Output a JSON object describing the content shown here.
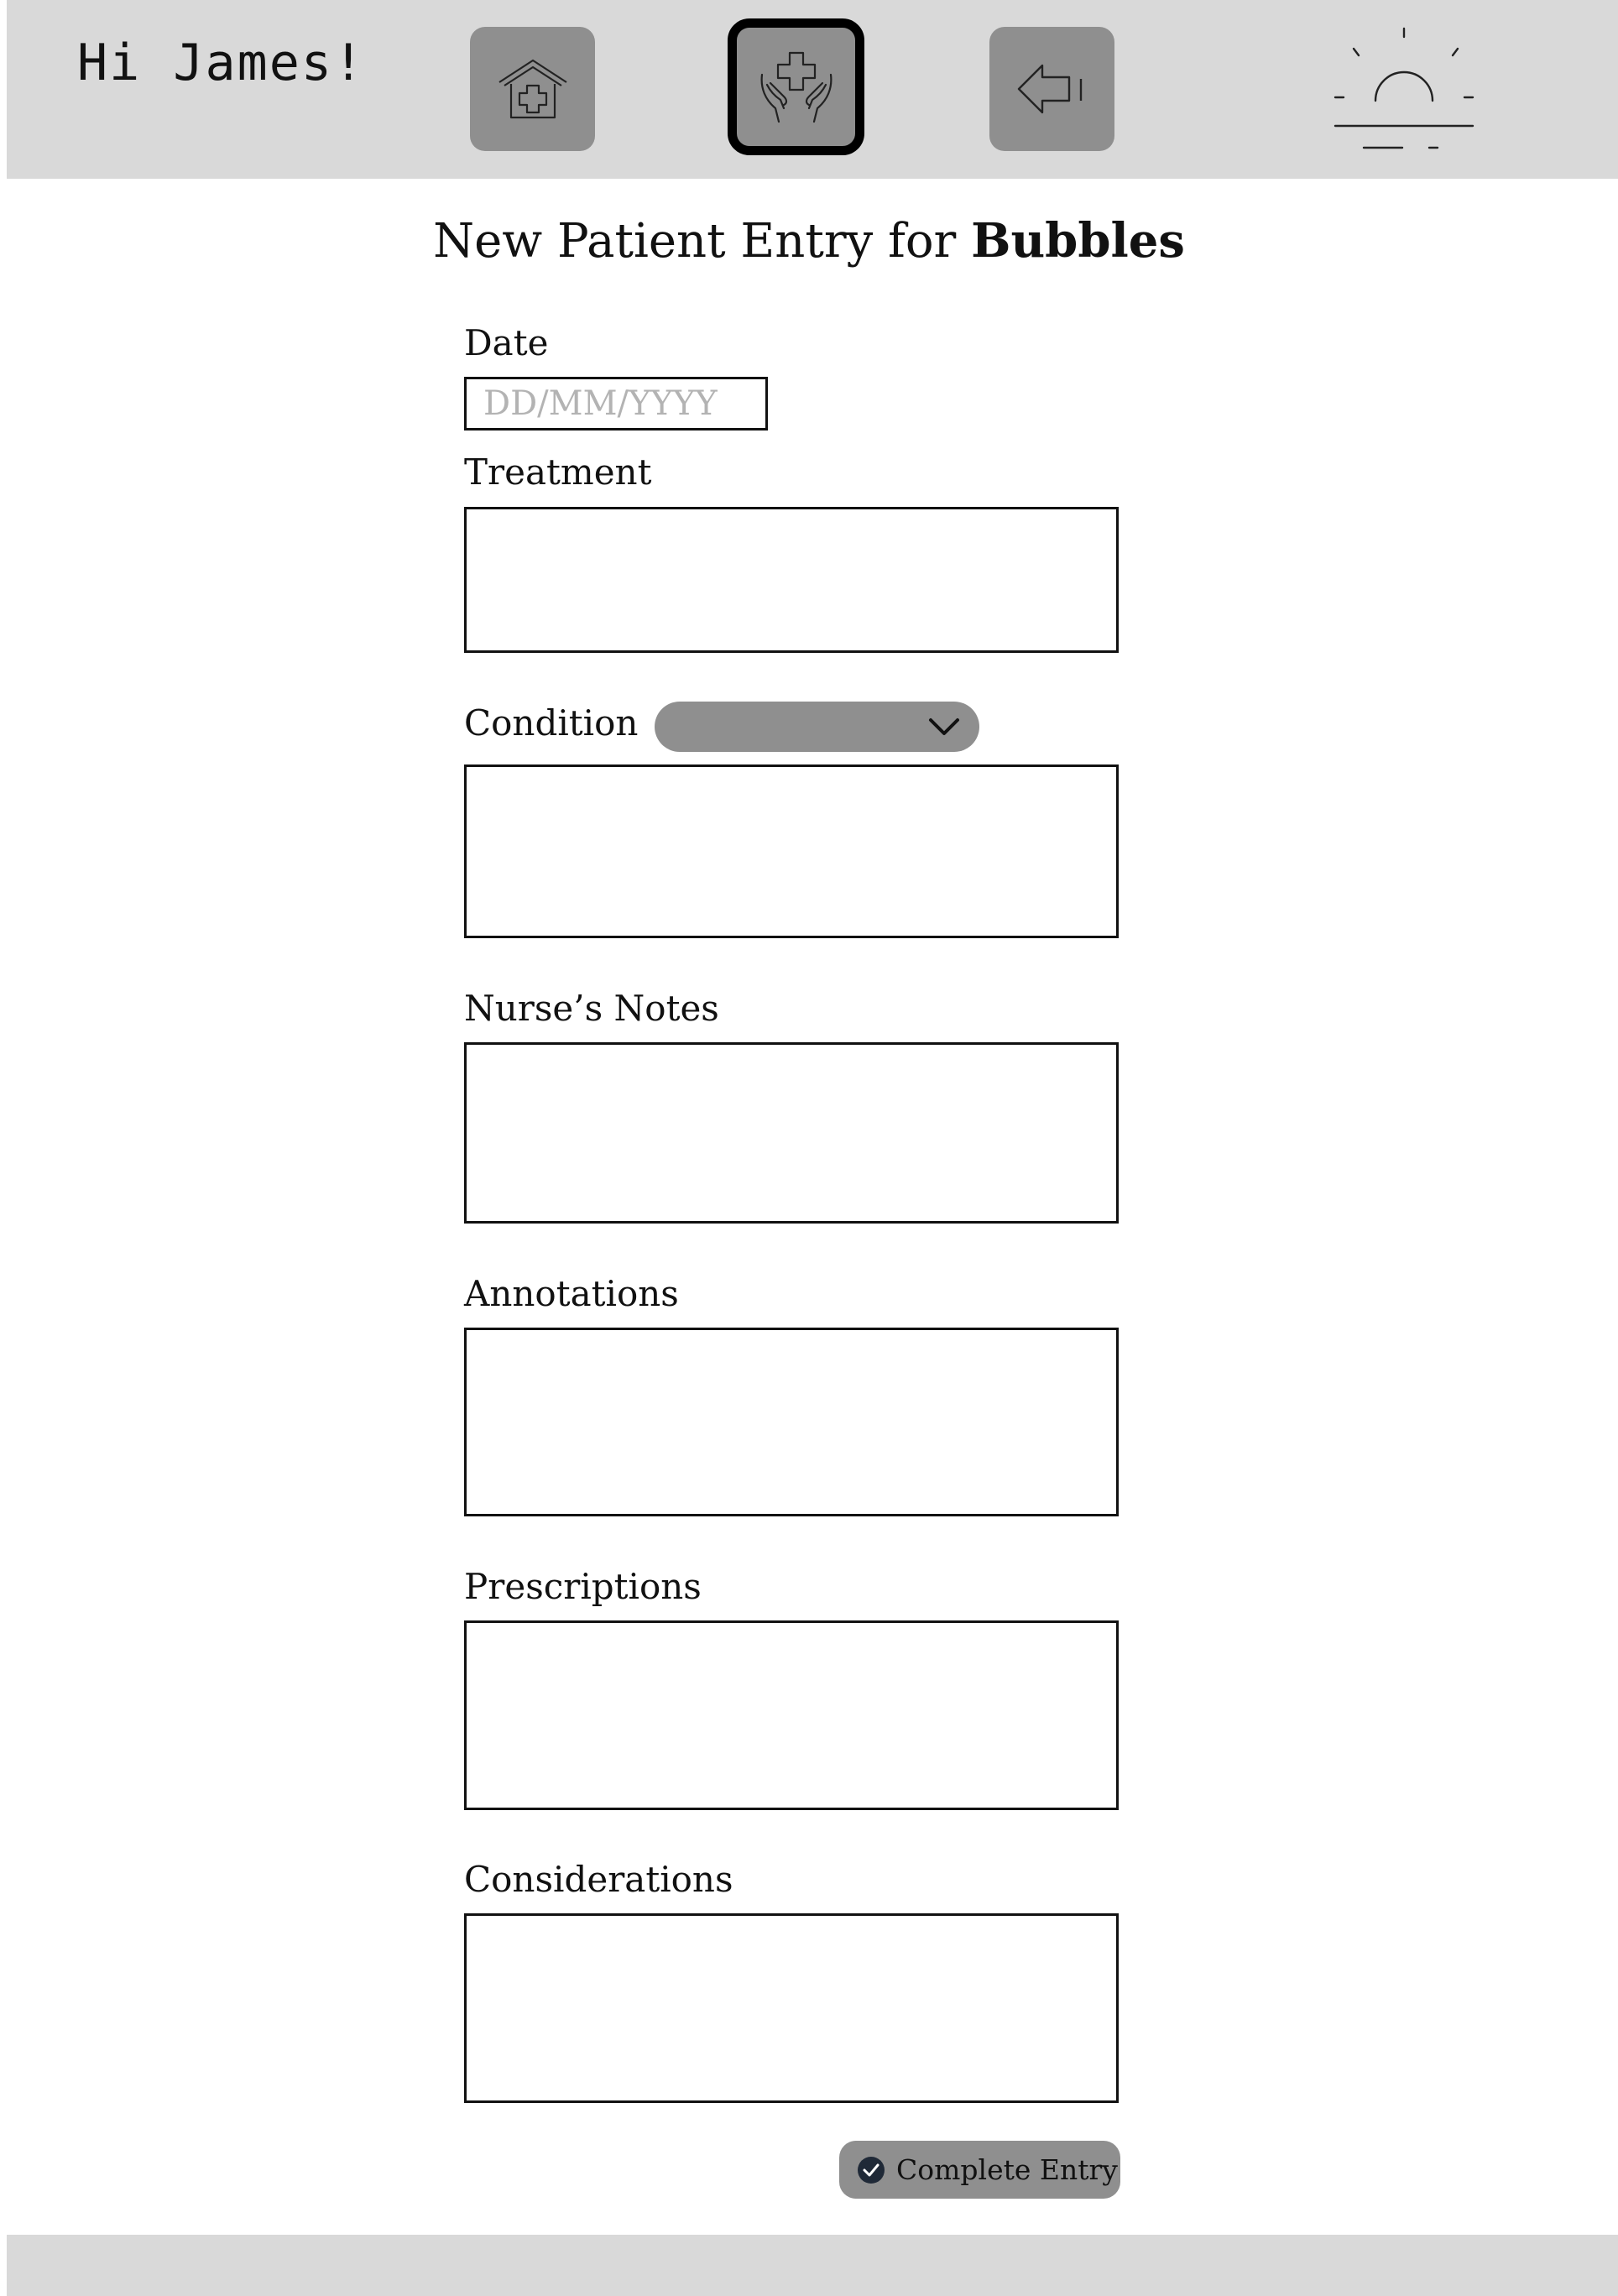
{
  "header": {
    "greeting": "Hi James!",
    "nav": [
      {
        "icon": "hospital-home-icon",
        "active": false
      },
      {
        "icon": "hands-care-icon",
        "active": true
      },
      {
        "icon": "back-arrow-icon",
        "active": false
      }
    ],
    "sun_icon": "sunrise-icon"
  },
  "title": {
    "prefix": "New Patient Entry for ",
    "patient_name": "Bubbles"
  },
  "form": {
    "date_label": "Date",
    "date_placeholder": "DD/MM/YYYY",
    "date_value": "",
    "treatment_label": "Treatment",
    "treatment_value": "",
    "condition_label": "Condition",
    "condition_selected": "",
    "condition_value": "",
    "nurses_notes_label": "Nurse’s Notes",
    "nurses_notes_value": "",
    "annotations_label": "Annotations",
    "annotations_value": "",
    "prescriptions_label": "Prescriptions",
    "prescriptions_value": "",
    "considerations_label": "Considerations",
    "considerations_value": ""
  },
  "actions": {
    "complete_label": "Complete Entry"
  },
  "colors": {
    "header_bg": "#d9d9d9",
    "button_bg": "#8f8f8f",
    "placeholder": "#b3b3b3"
  }
}
